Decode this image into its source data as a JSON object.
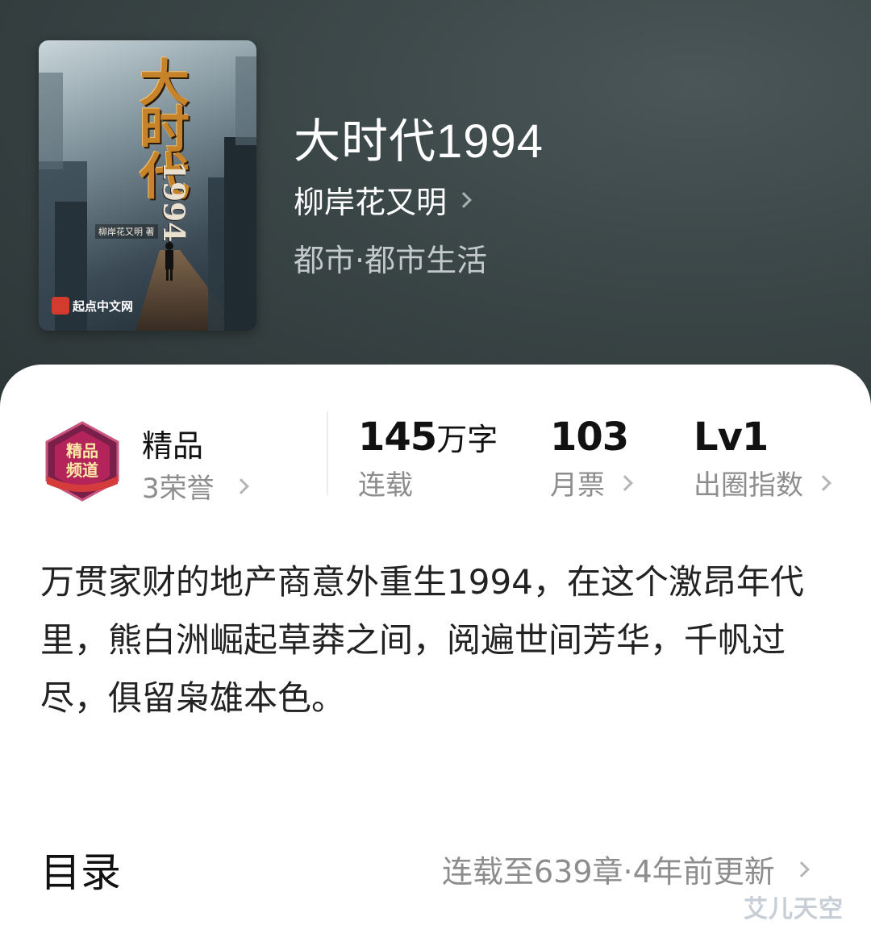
{
  "book": {
    "title": "大时代1994",
    "author": "柳岸花又明",
    "genre": "都市·都市生活"
  },
  "cover": {
    "title_text": "大时代",
    "year_text": "1994",
    "author_text": "柳岸花又明 著",
    "publisher_text": "起点中文网"
  },
  "honor": {
    "label": "精品",
    "count": "3荣誉",
    "badge_text": "精品频道"
  },
  "stats": [
    {
      "value": "145",
      "unit": "万字",
      "label": "连载"
    },
    {
      "value": "103",
      "unit": "",
      "label": "月票"
    },
    {
      "value": "Lv1",
      "unit": "",
      "label": "出圈指数"
    }
  ],
  "description": "万贯家财的地产商意外重生1994，在这个激昂年代里，熊白洲崛起草莽之间，阅遍世间芳华，千帆过尽，俱留枭雄本色。",
  "toc": {
    "title": "目录",
    "info": "连载至639章·4年前更新"
  },
  "watermark": "艾儿天空",
  "colors": {
    "header_bg": "#3a4546",
    "sheet_bg": "#ffffff",
    "cover_title": "#c7832a",
    "muted_text": "#8d8d8d"
  }
}
